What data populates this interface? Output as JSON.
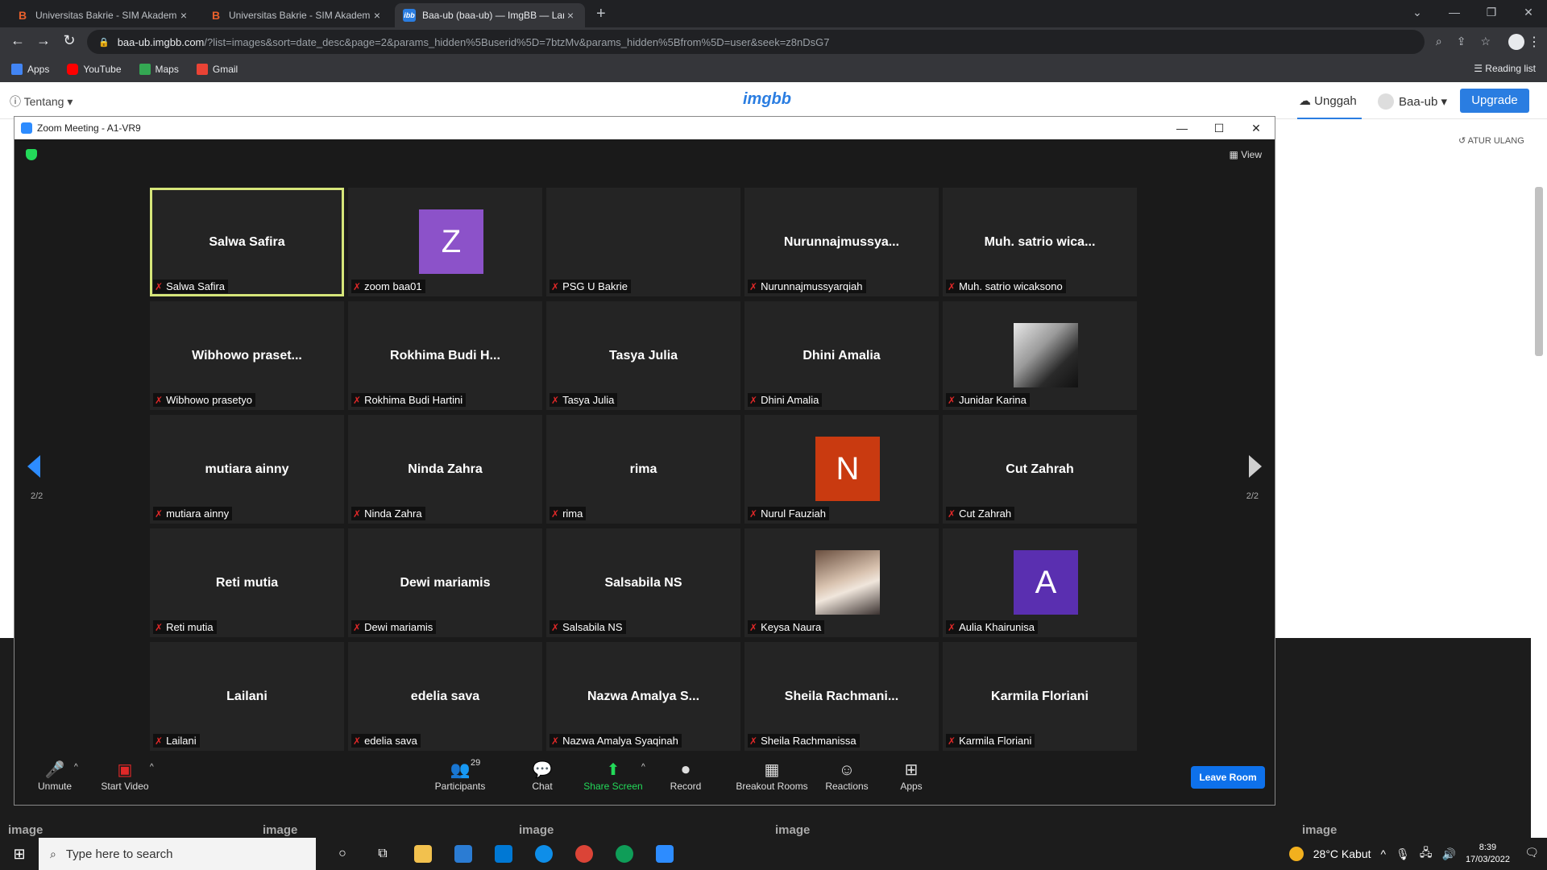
{
  "browser": {
    "tabs": [
      {
        "title": "Universitas Bakrie - SIM Akadem",
        "favicon": "B",
        "active": false
      },
      {
        "title": "Universitas Bakrie - SIM Akadem",
        "favicon": "B",
        "active": false
      },
      {
        "title": "Baa-ub (baa-ub) — ImgBB — Lar",
        "favicon": "ibb",
        "active": true
      }
    ],
    "url_domain": "baa-ub.imgbb.com",
    "url_rest": "/?list=images&sort=date_desc&page=2&params_hidden%5Buserid%5D=7btzMv&params_hidden%5Bfrom%5D=user&seek=z8nDsG7",
    "bookmarks": [
      {
        "label": "Apps",
        "icon": "apps-grid-icon",
        "color": "#4285f4"
      },
      {
        "label": "YouTube",
        "icon": "youtube-icon",
        "color": "#ff0000"
      },
      {
        "label": "Maps",
        "icon": "maps-icon",
        "color": "#34a853"
      },
      {
        "label": "Gmail",
        "icon": "gmail-icon",
        "color": "#ea4335"
      }
    ],
    "reading_list": "Reading list"
  },
  "imgbb": {
    "tentang": "Tentang",
    "logo": "imgbb",
    "unggah": "Unggah",
    "account": "Baa-ub",
    "upgrade": "Upgrade",
    "atur_ulang": "ATUR ULANG",
    "bg_labels": [
      "image",
      "image",
      "image",
      "image",
      "image"
    ]
  },
  "zoom": {
    "title": "Zoom Meeting - A1-VR9",
    "view": "View",
    "page_left": "2/2",
    "page_right": "2/2",
    "participants": [
      {
        "display": "Salwa Safira",
        "label": "Salwa Safira",
        "speaking": true
      },
      {
        "display": "",
        "label": "zoom baa01",
        "avatar": "Z",
        "avatar_color": "#8c52c9"
      },
      {
        "display": "",
        "label": "PSG U Bakrie"
      },
      {
        "display": "Nurunnajmussya...",
        "label": "Nurunnajmussyarqiah"
      },
      {
        "display": "Muh. satrio wica...",
        "label": "Muh. satrio wicaksono"
      },
      {
        "display": "Wibhowo  praset...",
        "label": "Wibhowo prasetyo"
      },
      {
        "display": "Rokhima  Budi  H...",
        "label": "Rokhima Budi Hartini"
      },
      {
        "display": "Tasya Julia",
        "label": "Tasya Julia"
      },
      {
        "display": "Dhini Amalia",
        "label": "Dhini Amalia"
      },
      {
        "display": "",
        "label": "Junidar Karina",
        "photo": "dark"
      },
      {
        "display": "mutiara ainny",
        "label": "mutiara ainny"
      },
      {
        "display": "Ninda Zahra",
        "label": "Ninda Zahra"
      },
      {
        "display": "rima",
        "label": "rima"
      },
      {
        "display": "",
        "label": "Nurul Fauziah",
        "avatar": "N",
        "avatar_color": "#c93a10"
      },
      {
        "display": "Cut Zahrah",
        "label": "Cut Zahrah"
      },
      {
        "display": "Reti mutia",
        "label": "Reti mutia"
      },
      {
        "display": "Dewi mariamis",
        "label": "Dewi mariamis"
      },
      {
        "display": "Salsabila NS",
        "label": "Salsabila NS"
      },
      {
        "display": "",
        "label": "Keysa Naura",
        "photo": "light"
      },
      {
        "display": "",
        "label": "Aulia Khairunisa",
        "avatar": "A",
        "avatar_color": "#5a2fb0"
      },
      {
        "display": "Lailani",
        "label": "Lailani"
      },
      {
        "display": "edelia sava",
        "label": "edelia sava"
      },
      {
        "display": "Nazwa Amalya S...",
        "label": "Nazwa Amalya Syaqinah"
      },
      {
        "display": "Sheila  Rachmani...",
        "label": "Sheila Rachmanissa"
      },
      {
        "display": "Karmila Floriani",
        "label": "Karmila Floriani"
      }
    ],
    "toolbar": {
      "unmute": "Unmute",
      "start_video": "Start Video",
      "participants": "Participants",
      "participant_count": "29",
      "chat": "Chat",
      "share_screen": "Share Screen",
      "record": "Record",
      "breakout_rooms": "Breakout Rooms",
      "reactions": "Reactions",
      "apps": "Apps",
      "leave_room": "Leave Room"
    }
  },
  "taskbar": {
    "search_placeholder": "Type here to search",
    "weather": "28°C  Kabut",
    "time": "8:39",
    "date": "17/03/2022"
  }
}
